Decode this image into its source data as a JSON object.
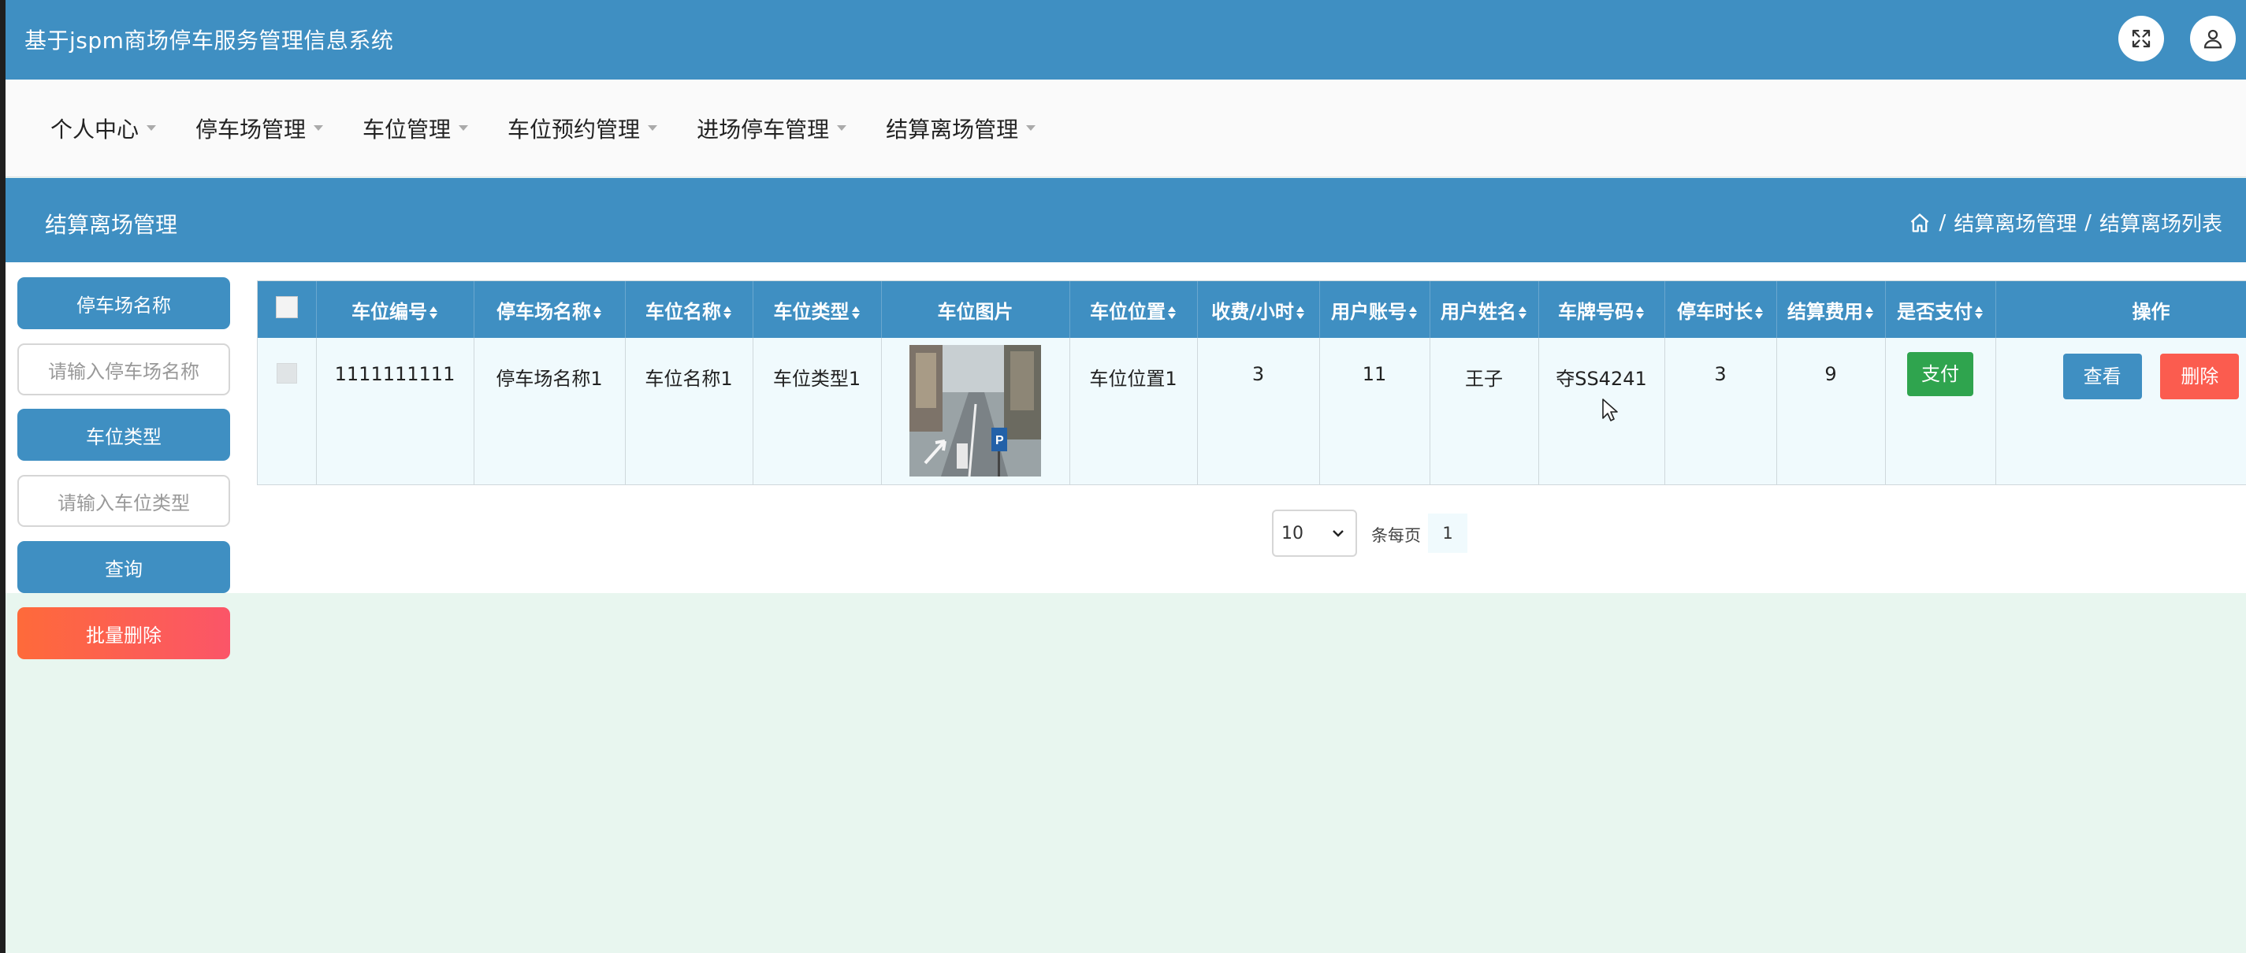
{
  "header": {
    "app_title": "基于jspm商场停车服务管理信息系统"
  },
  "nav": {
    "items": [
      {
        "label": "个人中心"
      },
      {
        "label": "停车场管理"
      },
      {
        "label": "车位管理"
      },
      {
        "label": "车位预约管理"
      },
      {
        "label": "进场停车管理"
      },
      {
        "label": "结算离场管理"
      }
    ]
  },
  "page": {
    "title": "结算离场管理",
    "breadcrumb": [
      "结算离场管理",
      "结算离场列表"
    ]
  },
  "filters": {
    "lot_name_label": "停车场名称",
    "lot_name_placeholder": "请输入停车场名称",
    "space_type_label": "车位类型",
    "space_type_placeholder": "请输入车位类型",
    "query_label": "查询",
    "batch_delete_label": "批量删除"
  },
  "table": {
    "columns": [
      "车位编号",
      "停车场名称",
      "车位名称",
      "车位类型",
      "车位图片",
      "车位位置",
      "收费/小时",
      "用户账号",
      "用户姓名",
      "车牌号码",
      "停车时长",
      "结算费用",
      "是否支付",
      "操作"
    ],
    "rows": [
      {
        "space_no": "1111111111",
        "lot_name": "停车场名称1",
        "space_name": "车位名称1",
        "space_type": "车位类型1",
        "space_location": "车位位置1",
        "fee_per_hour": "3",
        "user_account": "11",
        "user_name": "王子",
        "plate_no": "夺SS4241",
        "duration": "3",
        "settle_fee": "9",
        "pay_label": "支付",
        "view_label": "查看",
        "delete_label": "删除"
      }
    ]
  },
  "pagination": {
    "page_size": "10",
    "per_page_label": "条每页",
    "current_page": "1"
  },
  "colors": {
    "primary": "#3f8fc2",
    "pay_green": "#2fa44e",
    "danger": "#fb5c4f",
    "page_bg": "#e8f6ef"
  }
}
